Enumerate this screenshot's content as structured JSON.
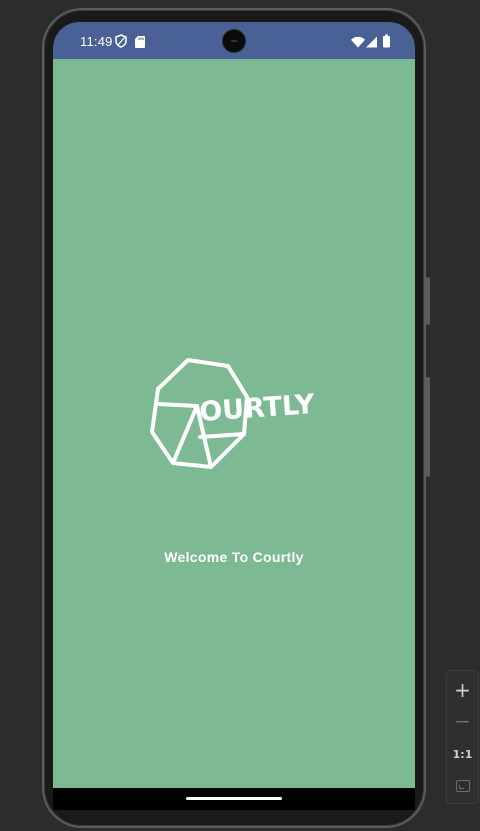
{
  "status_bar": {
    "time": "11:49",
    "icons_left": [
      "shield-icon",
      "sd-card-icon"
    ],
    "icons_right": [
      "wifi-icon",
      "cell-signal-icon",
      "battery-icon"
    ],
    "background_color": "#4a6195"
  },
  "app": {
    "background_color": "#7db993",
    "logo_text": "OURTLY",
    "welcome_text": "Welcome To Courtly"
  },
  "emulator_controls": {
    "zoom_in_label": "+",
    "zoom_out_label": "−",
    "actual_size_label": "1:1",
    "fit_icon": "fit-screen-icon"
  }
}
